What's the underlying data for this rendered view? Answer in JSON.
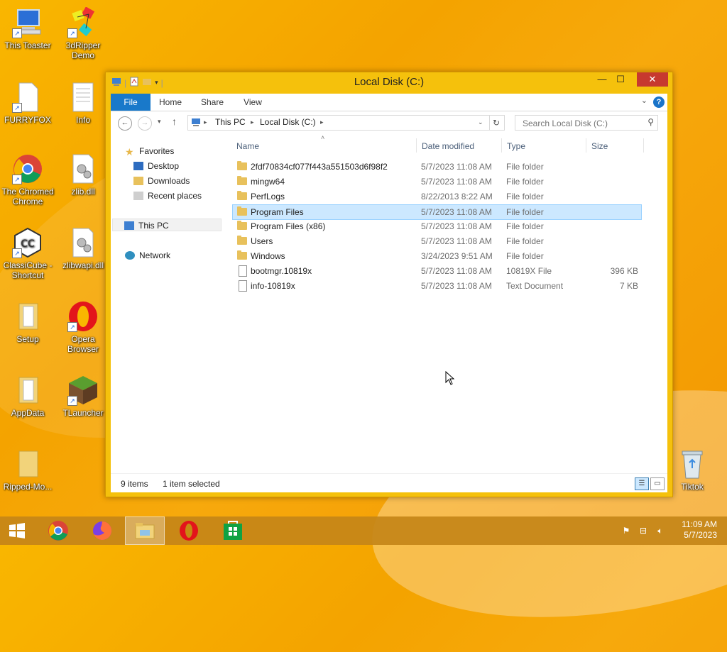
{
  "desktop": {
    "icons": [
      {
        "id": "this-toaster",
        "label": "This Toaster"
      },
      {
        "id": "3dripper",
        "label": "3dRipper Demo"
      },
      {
        "id": "furryfox",
        "label": "FURRYFOX"
      },
      {
        "id": "info",
        "label": "Info"
      },
      {
        "id": "chrome",
        "label": "The Chromed Chrome"
      },
      {
        "id": "zlib",
        "label": "zlib.dll"
      },
      {
        "id": "classicube",
        "label": "ClassiCube - Shortcut"
      },
      {
        "id": "zlibwapi",
        "label": "zlibwapi.dll"
      },
      {
        "id": "setup",
        "label": "Setup"
      },
      {
        "id": "opera",
        "label": "Opera Browser"
      },
      {
        "id": "appdata",
        "label": "AppData"
      },
      {
        "id": "tlauncher",
        "label": "TLauncher"
      },
      {
        "id": "ripped",
        "label": "Ripped-Mo..."
      },
      {
        "id": "tiktok",
        "label": "Tiktok"
      }
    ]
  },
  "window": {
    "title": "Local Disk (C:)",
    "buttons": {
      "minimize": "—",
      "maximize": "☐",
      "close": "✕"
    },
    "ribbon_tabs": [
      "File",
      "Home",
      "Share",
      "View"
    ],
    "help": "?",
    "address": {
      "segments": [
        "This PC",
        "Local Disk (C:)"
      ]
    },
    "search": {
      "placeholder": "Search Local Disk (C:)"
    },
    "nav_pane": {
      "favorites": "Favorites",
      "desktop": "Desktop",
      "downloads": "Downloads",
      "recent": "Recent places",
      "this_pc": "This PC",
      "network": "Network"
    },
    "columns": {
      "name": "Name",
      "date": "Date modified",
      "type": "Type",
      "size": "Size"
    },
    "files": [
      {
        "name": "2fdf70834cf077f443a551503d6f98f2",
        "date": "5/7/2023 11:08 AM",
        "type": "File folder",
        "size": "",
        "kind": "folder"
      },
      {
        "name": "mingw64",
        "date": "5/7/2023 11:08 AM",
        "type": "File folder",
        "size": "",
        "kind": "folder"
      },
      {
        "name": "PerfLogs",
        "date": "8/22/2013 8:22 AM",
        "type": "File folder",
        "size": "",
        "kind": "folder"
      },
      {
        "name": "Program Files",
        "date": "5/7/2023 11:08 AM",
        "type": "File folder",
        "size": "",
        "kind": "folder",
        "selected": true
      },
      {
        "name": "Program Files (x86)",
        "date": "5/7/2023 11:08 AM",
        "type": "File folder",
        "size": "",
        "kind": "folder"
      },
      {
        "name": "Users",
        "date": "5/7/2023 11:08 AM",
        "type": "File folder",
        "size": "",
        "kind": "folder"
      },
      {
        "name": "Windows",
        "date": "3/24/2023 9:51 AM",
        "type": "File folder",
        "size": "",
        "kind": "folder"
      },
      {
        "name": "bootmgr.10819x",
        "date": "5/7/2023 11:08 AM",
        "type": "10819X File",
        "size": "396 KB",
        "kind": "file"
      },
      {
        "name": "info-10819x",
        "date": "5/7/2023 11:08 AM",
        "type": "Text Document",
        "size": "7 KB",
        "kind": "file"
      }
    ],
    "status": {
      "count": "9 items",
      "selection": "1 item selected"
    }
  },
  "taskbar": {
    "clock": {
      "time": "11:09 AM",
      "date": "5/7/2023"
    }
  },
  "colors": {
    "accent": "#1979ca",
    "selection": "#cce8ff",
    "close": "#c7392f"
  }
}
